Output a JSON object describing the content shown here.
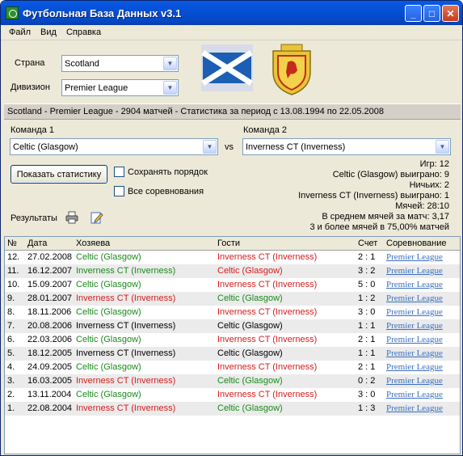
{
  "window": {
    "title": "Футбольная База Данных v3.1",
    "controls": {
      "minimize": "_",
      "maximize": "□",
      "close": "✕"
    }
  },
  "menu": [
    "Файл",
    "Вид",
    "Справка"
  ],
  "filters": {
    "country_label": "Страна",
    "country_value": "Scotland",
    "division_label": "Дивизион",
    "division_value": "Premier League"
  },
  "info_bar": "Scotland - Premier League - 2904 матчей - Статистика за период с 13.08.1994 по 22.05.2008",
  "teams": {
    "team1_label": "Команда 1",
    "team1_value": "Celtic (Glasgow)",
    "vs": "vs",
    "team2_label": "Команда 2",
    "team2_value": "Inverness CT (Inverness)"
  },
  "actions": {
    "show_stats": "Показать статистику",
    "keep_order": "Сохранять порядок",
    "all_competitions": "Все соревнования",
    "results_label": "Результаты"
  },
  "stats": [
    "Игр: 12",
    "Celtic (Glasgow) выиграно: 9",
    "Ничьих: 2",
    "Inverness CT (Inverness) выиграно: 1",
    "Мячей: 28:10",
    "В среднем мячей за матч: 3,17",
    "3 и более мячей в 75,00% матчей"
  ],
  "grid": {
    "columns": [
      "№",
      "Дата",
      "Хозяева",
      "Гости",
      "Счет",
      "Соревнование"
    ],
    "rows": [
      {
        "n": "12.",
        "date": "27.02.2008",
        "home": "Celtic (Glasgow)",
        "home_r": "win",
        "away": "Inverness CT (Inverness)",
        "away_r": "lose",
        "score": "2 : 1",
        "comp": "Premier League"
      },
      {
        "n": "11.",
        "date": "16.12.2007",
        "home": "Inverness CT (Inverness)",
        "home_r": "win",
        "away": "Celtic (Glasgow)",
        "away_r": "lose",
        "score": "3 : 2",
        "comp": "Premier League"
      },
      {
        "n": "10.",
        "date": "15.09.2007",
        "home": "Celtic (Glasgow)",
        "home_r": "win",
        "away": "Inverness CT (Inverness)",
        "away_r": "lose",
        "score": "5 : 0",
        "comp": "Premier League"
      },
      {
        "n": "9.",
        "date": "28.01.2007",
        "home": "Inverness CT (Inverness)",
        "home_r": "lose",
        "away": "Celtic (Glasgow)",
        "away_r": "win",
        "score": "1 : 2",
        "comp": "Premier League"
      },
      {
        "n": "8.",
        "date": "18.11.2006",
        "home": "Celtic (Glasgow)",
        "home_r": "win",
        "away": "Inverness CT (Inverness)",
        "away_r": "lose",
        "score": "3 : 0",
        "comp": "Premier League"
      },
      {
        "n": "7.",
        "date": "20.08.2006",
        "home": "Inverness CT (Inverness)",
        "home_r": "neutral",
        "away": "Celtic (Glasgow)",
        "away_r": "neutral",
        "score": "1 : 1",
        "comp": "Premier League"
      },
      {
        "n": "6.",
        "date": "22.03.2006",
        "home": "Celtic (Glasgow)",
        "home_r": "win",
        "away": "Inverness CT (Inverness)",
        "away_r": "lose",
        "score": "2 : 1",
        "comp": "Premier League"
      },
      {
        "n": "5.",
        "date": "18.12.2005",
        "home": "Inverness CT (Inverness)",
        "home_r": "neutral",
        "away": "Celtic (Glasgow)",
        "away_r": "neutral",
        "score": "1 : 1",
        "comp": "Premier League"
      },
      {
        "n": "4.",
        "date": "24.09.2005",
        "home": "Celtic (Glasgow)",
        "home_r": "win",
        "away": "Inverness CT (Inverness)",
        "away_r": "lose",
        "score": "2 : 1",
        "comp": "Premier League"
      },
      {
        "n": "3.",
        "date": "16.03.2005",
        "home": "Inverness CT (Inverness)",
        "home_r": "lose",
        "away": "Celtic (Glasgow)",
        "away_r": "win",
        "score": "0 : 2",
        "comp": "Premier League"
      },
      {
        "n": "2.",
        "date": "13.11.2004",
        "home": "Celtic (Glasgow)",
        "home_r": "win",
        "away": "Inverness CT (Inverness)",
        "away_r": "lose",
        "score": "3 : 0",
        "comp": "Premier League"
      },
      {
        "n": "1.",
        "date": "22.08.2004",
        "home": "Inverness CT (Inverness)",
        "home_r": "lose",
        "away": "Celtic (Glasgow)",
        "away_r": "win",
        "score": "1 : 3",
        "comp": "Premier League"
      }
    ]
  },
  "colors": {
    "win": "#1a8a1a",
    "lose": "#d81b1b",
    "link": "#3a6fc0"
  }
}
